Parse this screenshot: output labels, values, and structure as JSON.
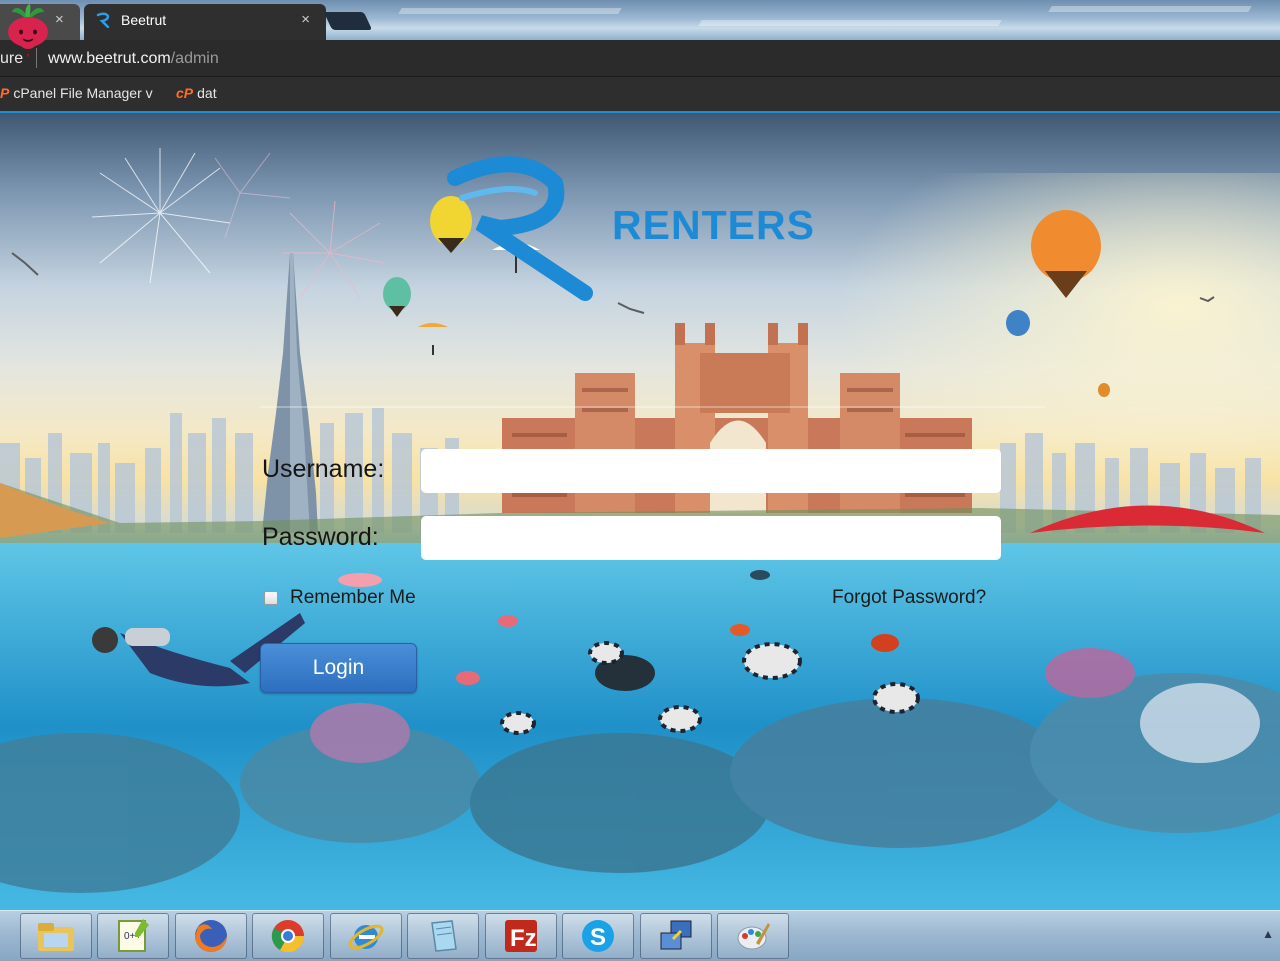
{
  "browser": {
    "tabs": [
      {
        "title": "",
        "close": "×"
      },
      {
        "title": "Beetrut",
        "close": "×"
      }
    ],
    "address": {
      "secure_fragment": "ure",
      "host": "www.beetrut.com",
      "path": "/admin"
    },
    "bookmarks": [
      {
        "icon": "cpanel-icon",
        "label": "cPanel File Manager v",
        "chevron": "v"
      },
      {
        "icon": "cpanel-icon",
        "label": "dat"
      }
    ]
  },
  "brand": {
    "name": "RENTERS",
    "colors": {
      "primary": "#1d8ad6",
      "button": "#3a7fcf"
    }
  },
  "login": {
    "username_label": "Username:",
    "password_label": "Password:",
    "username_value": "",
    "password_value": "",
    "remember_label": "Remember Me",
    "remember_checked": false,
    "forgot_label": "Forgot Password?",
    "submit_label": "Login"
  },
  "taskbar": {
    "apps": [
      {
        "name": "file-explorer-icon"
      },
      {
        "name": "notepad-plus-plus-icon"
      },
      {
        "name": "firefox-icon"
      },
      {
        "name": "chrome-icon"
      },
      {
        "name": "internet-explorer-icon"
      },
      {
        "name": "notepad-icon"
      },
      {
        "name": "filezilla-icon"
      },
      {
        "name": "skype-icon"
      },
      {
        "name": "remote-desktop-icon"
      },
      {
        "name": "paint-icon"
      }
    ],
    "tray": "▲"
  }
}
